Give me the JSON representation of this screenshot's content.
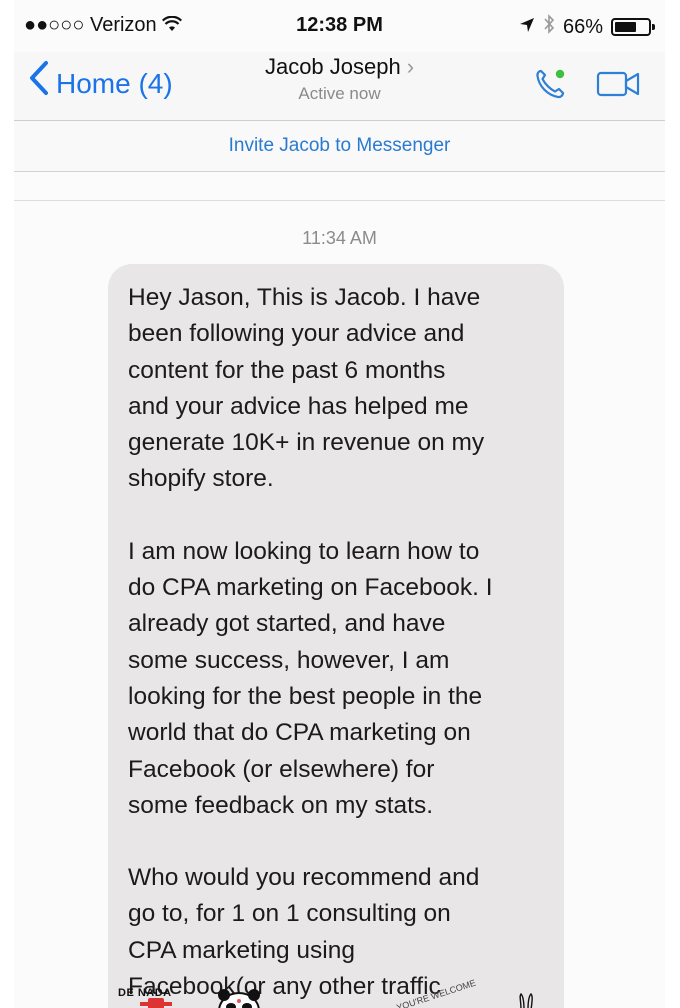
{
  "status_bar": {
    "carrier": "●●○○○ Verizon",
    "time": "12:38 PM",
    "battery": "66%",
    "battery_level": 0.66
  },
  "nav": {
    "back_label": "Home (4)",
    "contact_name": "Jacob Joseph",
    "active_status": "Active now",
    "accent_color": "#1a73e8"
  },
  "invite": {
    "label": "Invite Jacob to Messenger"
  },
  "thread": {
    "timestamp": "11:34 AM",
    "message_paragraphs": [
      "Hey Jason, This is Jacob. I have\nbeen following your advice and\ncontent for the past 6 months\nand your advice has helped me\ngenerate 10K+ in revenue on my\nshopify store.",
      "I am now looking to learn how to\ndo CPA marketing on Facebook. I\nalready got started, and have\nsome success, however, I am\nlooking for the best people in the\nworld that do CPA marketing on\nFacebook (or elsewhere) for\nsome feedback on my stats.",
      "Who would you recommend and\ngo to, for 1 on 1 consulting on\nCPA marketing using\nFacebook(or any other traffic"
    ]
  },
  "stickers": {
    "de_nada": "DE NADA",
    "welcome": "YOU'RE WELCOME"
  }
}
